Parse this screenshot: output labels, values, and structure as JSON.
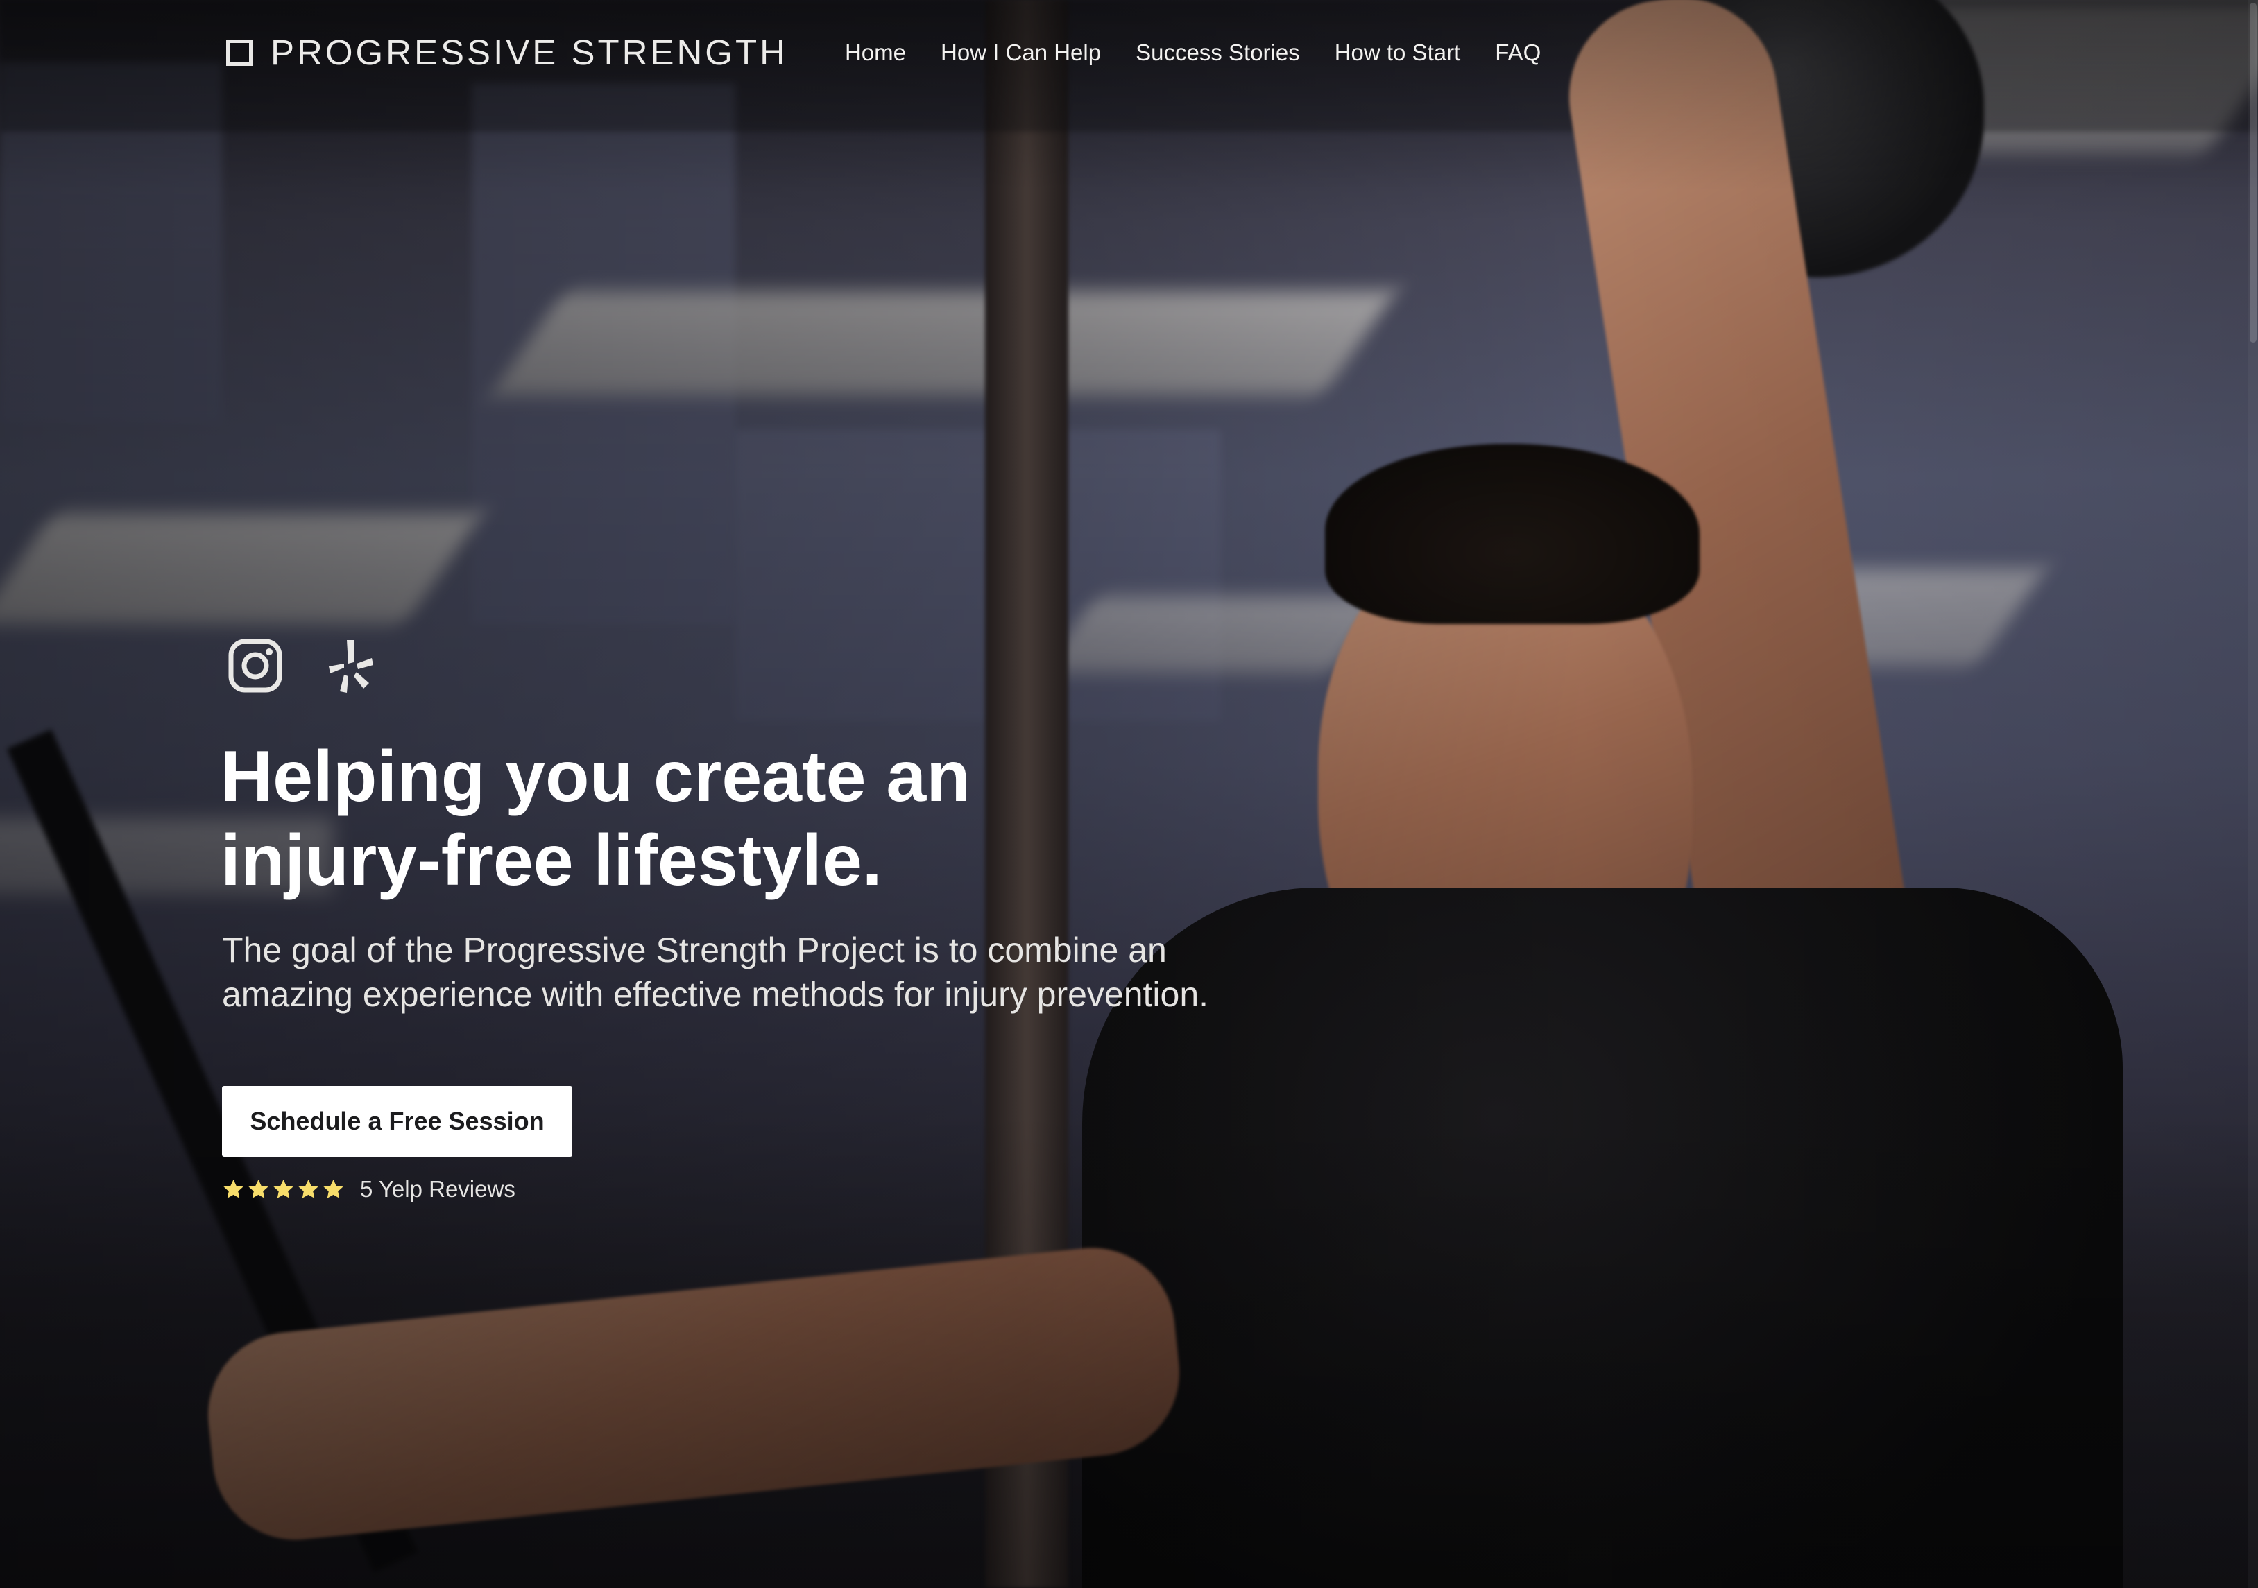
{
  "brand": {
    "name": "PROGRESSIVE STRENGTH"
  },
  "nav": {
    "items": [
      {
        "label": "Home"
      },
      {
        "label": "How I Can Help"
      },
      {
        "label": "Success Stories"
      },
      {
        "label": "How to Start"
      },
      {
        "label": "FAQ"
      }
    ]
  },
  "social": {
    "icons": [
      "instagram-icon",
      "yelp-icon"
    ]
  },
  "hero": {
    "title_line1": "Helping you create an",
    "title_line2": "injury-free lifestyle.",
    "subtitle_line1": "The goal of the Progressive Strength Project is to combine an",
    "subtitle_line2": "amazing experience with effective methods for injury prevention.",
    "cta_label": "Schedule a Free Session"
  },
  "rating": {
    "stars": 5,
    "label": "5 Yelp Reviews",
    "star_color": "#f7dd6b"
  },
  "colors": {
    "text": "#ffffff",
    "button_bg": "#ffffff",
    "button_text": "#1c1c1e"
  }
}
